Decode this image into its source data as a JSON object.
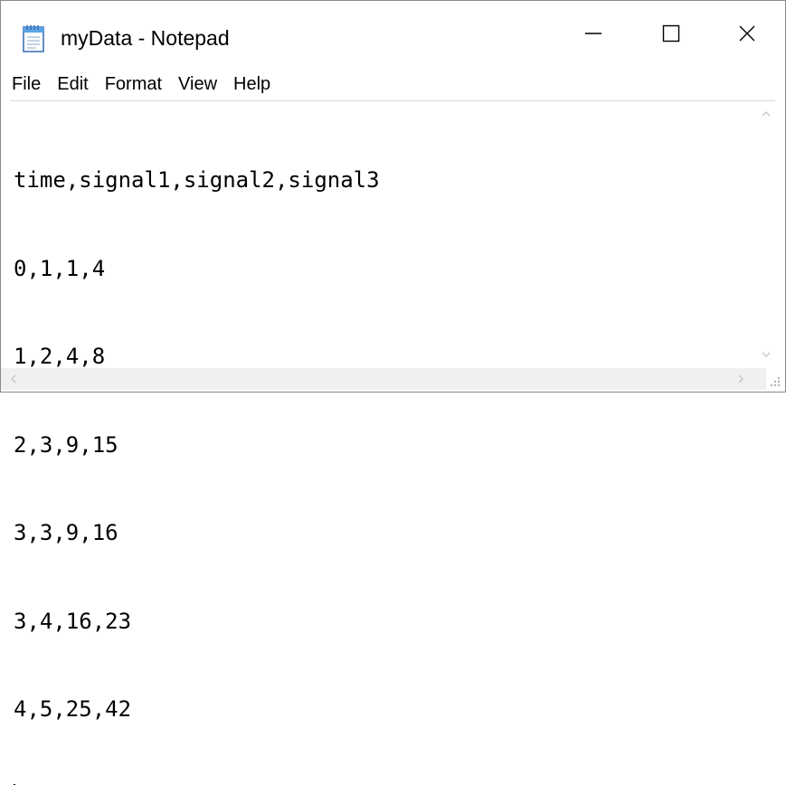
{
  "window": {
    "title": "myData - Notepad",
    "icon": "notepad-icon"
  },
  "controls": {
    "minimize_icon": "minimize-icon",
    "maximize_icon": "maximize-icon",
    "close_icon": "close-icon"
  },
  "menu": {
    "items": [
      {
        "label": "File"
      },
      {
        "label": "Edit"
      },
      {
        "label": "Format"
      },
      {
        "label": "View"
      },
      {
        "label": "Help"
      }
    ]
  },
  "document": {
    "lines": [
      "time,signal1,signal2,signal3",
      "0,1,1,4",
      "1,2,4,8",
      "2,3,9,15",
      "3,3,9,16",
      "3,4,16,23",
      "4,5,25,42"
    ]
  },
  "colors": {
    "window_border": "#8a8a8a",
    "scrollbar_track": "#f0f0f0",
    "arrow_disabled": "#c8c8c8",
    "text": "#000000"
  }
}
